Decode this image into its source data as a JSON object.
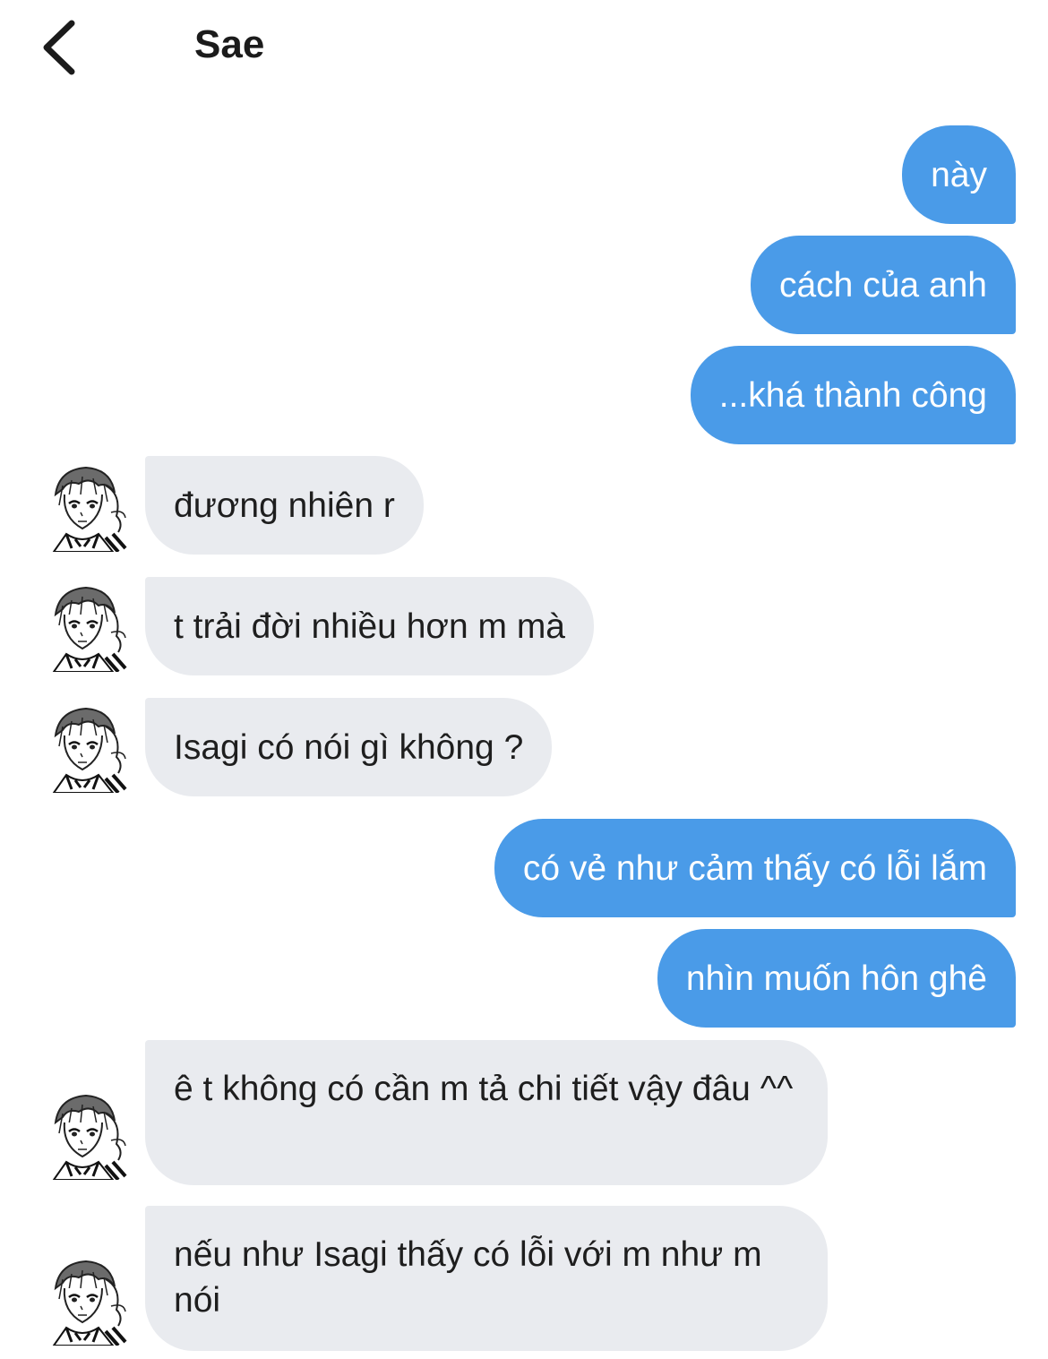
{
  "header": {
    "title": "Sae"
  },
  "icons": {
    "back": "chevron-left-icon",
    "avatar": "manga-portrait-avatar"
  },
  "colors": {
    "outgoing_bubble": "#4a9be8",
    "incoming_bubble": "#e9ebef",
    "background": "#ffffff"
  },
  "messages": [
    {
      "side": "outgoing",
      "text": "này"
    },
    {
      "side": "outgoing",
      "text": "cách của anh"
    },
    {
      "side": "outgoing",
      "text": "...khá thành công"
    },
    {
      "side": "incoming",
      "text": "đương nhiên r"
    },
    {
      "side": "incoming",
      "text": "t trải đời nhiều hơn m mà"
    },
    {
      "side": "incoming",
      "text": "Isagi có nói gì không ?"
    },
    {
      "side": "outgoing",
      "text": "có vẻ như cảm thấy có lỗi lắm"
    },
    {
      "side": "outgoing",
      "text": "nhìn muốn hôn ghê"
    },
    {
      "side": "incoming",
      "text": "ê t không có cần m tả chi tiết vậy đâu ^^"
    },
    {
      "side": "incoming",
      "text": "nếu như Isagi thấy có lỗi với m như m nói"
    }
  ]
}
